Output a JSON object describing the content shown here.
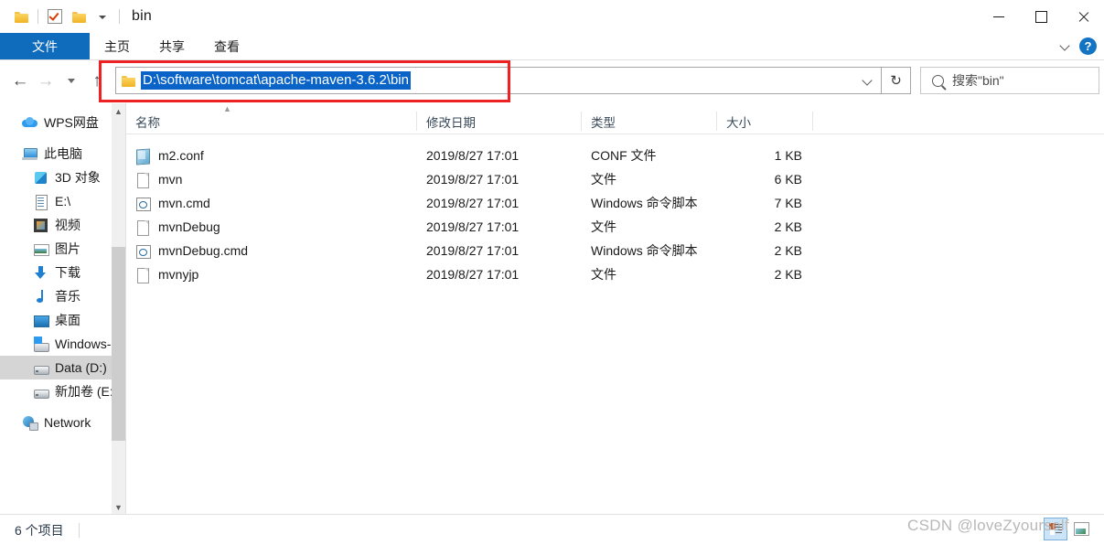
{
  "window": {
    "title": "bin",
    "quick_access": [
      "folder-icon",
      "properties-checkbox-icon",
      "new-folder-icon",
      "customize-caret-icon"
    ],
    "controls": {
      "minimize": "minimize",
      "maximize": "maximize",
      "close": "close"
    }
  },
  "ribbon": {
    "tabs": [
      {
        "label": "文件",
        "active": true
      },
      {
        "label": "主页",
        "active": false
      },
      {
        "label": "共享",
        "active": false
      },
      {
        "label": "查看",
        "active": false
      }
    ],
    "collapse_label": "collapse-ribbon",
    "help_label": "?"
  },
  "toolbar": {
    "back": "←",
    "forward": "→",
    "recent": "recent-locations",
    "up": "↑",
    "address": {
      "value": "D:\\software\\tomcat\\apache-maven-3.6.2\\bin",
      "selected": true,
      "dropdown": "previous-locations"
    },
    "refresh": "↻",
    "search": {
      "placeholder": "搜索\"bin\"",
      "value": ""
    }
  },
  "sidebar": {
    "items": [
      {
        "label": "WPS网盘",
        "icon": "cloud-icon",
        "indent": 0,
        "selected": false
      },
      {
        "label": "此电脑",
        "icon": "pc-icon",
        "indent": 0,
        "selected": false
      },
      {
        "label": "3D 对象",
        "icon": "cube-icon",
        "indent": 1,
        "selected": false
      },
      {
        "label": "E:\\",
        "icon": "document-icon",
        "indent": 1,
        "selected": false
      },
      {
        "label": "视频",
        "icon": "video-icon",
        "indent": 1,
        "selected": false
      },
      {
        "label": "图片",
        "icon": "picture-icon",
        "indent": 1,
        "selected": false
      },
      {
        "label": "下载",
        "icon": "download-icon",
        "indent": 1,
        "selected": false
      },
      {
        "label": "音乐",
        "icon": "music-icon",
        "indent": 1,
        "selected": false
      },
      {
        "label": "桌面",
        "icon": "desktop-icon",
        "indent": 1,
        "selected": false
      },
      {
        "label": "Windows-",
        "icon": "windows-drive-icon",
        "indent": 1,
        "selected": false
      },
      {
        "label": "Data (D:)",
        "icon": "drive-icon",
        "indent": 1,
        "selected": true
      },
      {
        "label": "新加卷 (E:)",
        "icon": "drive-icon",
        "indent": 1,
        "selected": false
      },
      {
        "label": "Network",
        "icon": "network-icon",
        "indent": 0,
        "selected": false
      }
    ]
  },
  "file_list": {
    "columns": [
      "名称",
      "修改日期",
      "类型",
      "大小"
    ],
    "sort_column": "名称",
    "sort_direction": "ascending",
    "rows": [
      {
        "name": "m2.conf",
        "icon": "conf-file-icon",
        "date": "2019/8/27 17:01",
        "type": "CONF 文件",
        "size": "1 KB"
      },
      {
        "name": "mvn",
        "icon": "plain-file-icon",
        "date": "2019/8/27 17:01",
        "type": "文件",
        "size": "6 KB"
      },
      {
        "name": "mvn.cmd",
        "icon": "cmd-script-icon",
        "date": "2019/8/27 17:01",
        "type": "Windows 命令脚本",
        "size": "7 KB"
      },
      {
        "name": "mvnDebug",
        "icon": "plain-file-icon",
        "date": "2019/8/27 17:01",
        "type": "文件",
        "size": "2 KB"
      },
      {
        "name": "mvnDebug.cmd",
        "icon": "cmd-script-icon",
        "date": "2019/8/27 17:01",
        "type": "Windows 命令脚本",
        "size": "2 KB"
      },
      {
        "name": "mvnyjp",
        "icon": "plain-file-icon",
        "date": "2019/8/27 17:01",
        "type": "文件",
        "size": "2 KB"
      }
    ]
  },
  "statusbar": {
    "item_count": "6 个项目",
    "view_details": "details-view",
    "view_icons": "large-icons-view"
  },
  "watermark": {
    "text": "CSDN @loveZyourself"
  },
  "annotation": {
    "color": "#ee2222",
    "target": "address-bar"
  }
}
